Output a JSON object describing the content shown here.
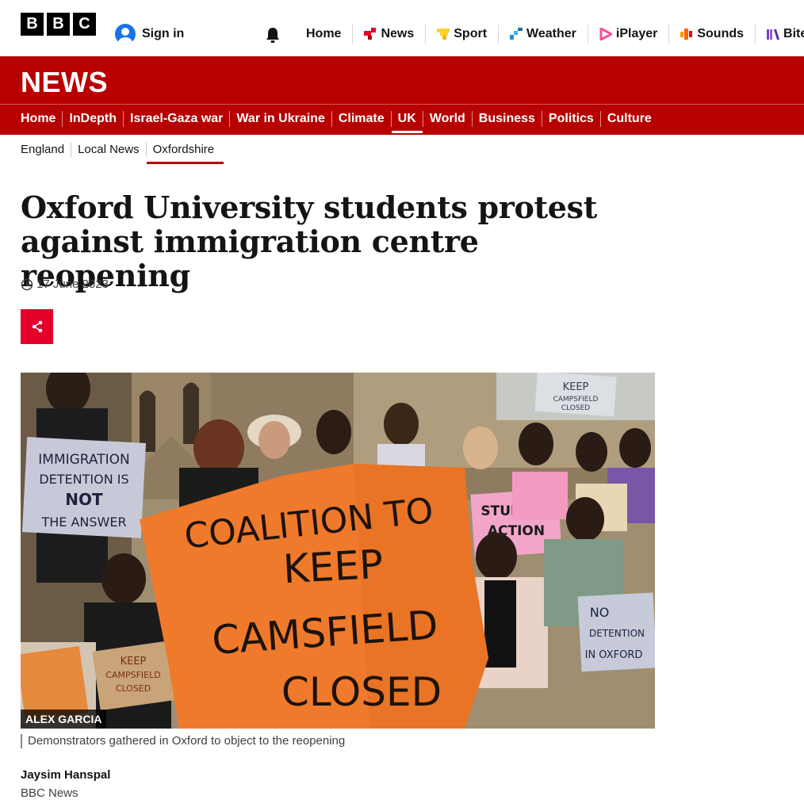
{
  "brand": {
    "logo_letters": [
      "B",
      "B",
      "C"
    ],
    "accent_red": "#b80000",
    "share_red": "#e4002b"
  },
  "header": {
    "sign_in_label": "Sign in",
    "notification_icon": "bell-icon",
    "global_nav": [
      {
        "label": "Home",
        "icon": "",
        "color": ""
      },
      {
        "label": "News",
        "icon": "news-icon",
        "color": "#e4002b"
      },
      {
        "label": "Sport",
        "icon": "sport-icon",
        "color": "#ffd230"
      },
      {
        "label": "Weather",
        "icon": "weather-icon",
        "color": "#1e90d2"
      },
      {
        "label": "iPlayer",
        "icon": "iplayer-icon",
        "color": "#ff4c98"
      },
      {
        "label": "Sounds",
        "icon": "sounds-icon",
        "color": "#ff6600"
      },
      {
        "label": "Bitesize",
        "icon": "bitesize-icon",
        "color": "#7a40c8"
      }
    ]
  },
  "news_bar": {
    "title": "NEWS",
    "nav": [
      {
        "label": "Home",
        "active": false
      },
      {
        "label": "InDepth",
        "active": false
      },
      {
        "label": "Israel-Gaza war",
        "active": false
      },
      {
        "label": "War in Ukraine",
        "active": false
      },
      {
        "label": "Climate",
        "active": false
      },
      {
        "label": "UK",
        "active": true
      },
      {
        "label": "World",
        "active": false
      },
      {
        "label": "Business",
        "active": false
      },
      {
        "label": "Politics",
        "active": false
      },
      {
        "label": "Culture",
        "active": false
      }
    ]
  },
  "sub_nav": [
    {
      "label": "England",
      "active": false
    },
    {
      "label": "Local News",
      "active": false
    },
    {
      "label": "Oxfordshire",
      "active": true
    }
  ],
  "article": {
    "headline": "Oxford University students protest against immigration centre reopening",
    "date": "17 June 2023",
    "share_icon": "share-icon",
    "image": {
      "credit": "ALEX GARCIA",
      "banner_text": [
        "COALITION TO",
        "KEEP",
        "CAMSFIELD",
        "CLOSED"
      ],
      "signs": {
        "left": [
          "IMMIGRATION",
          "DETENTION IS",
          "NOT",
          "THE ANSWER"
        ],
        "top": [
          "KEEP",
          "CAMPSFIELD",
          "CLOSED"
        ],
        "right_pink": [
          "STUDENT",
          "ACTION"
        ],
        "right_bottom": [
          "NO",
          "DETENTION",
          "IN OXFORD"
        ],
        "bottom_left": [
          "KEEP",
          "CAMPSFIELD",
          "CLOSED"
        ]
      }
    },
    "caption": "Demonstrators gathered in Oxford to object to the reopening",
    "author": "Jaysim Hanspal",
    "organisation": "BBC News"
  }
}
